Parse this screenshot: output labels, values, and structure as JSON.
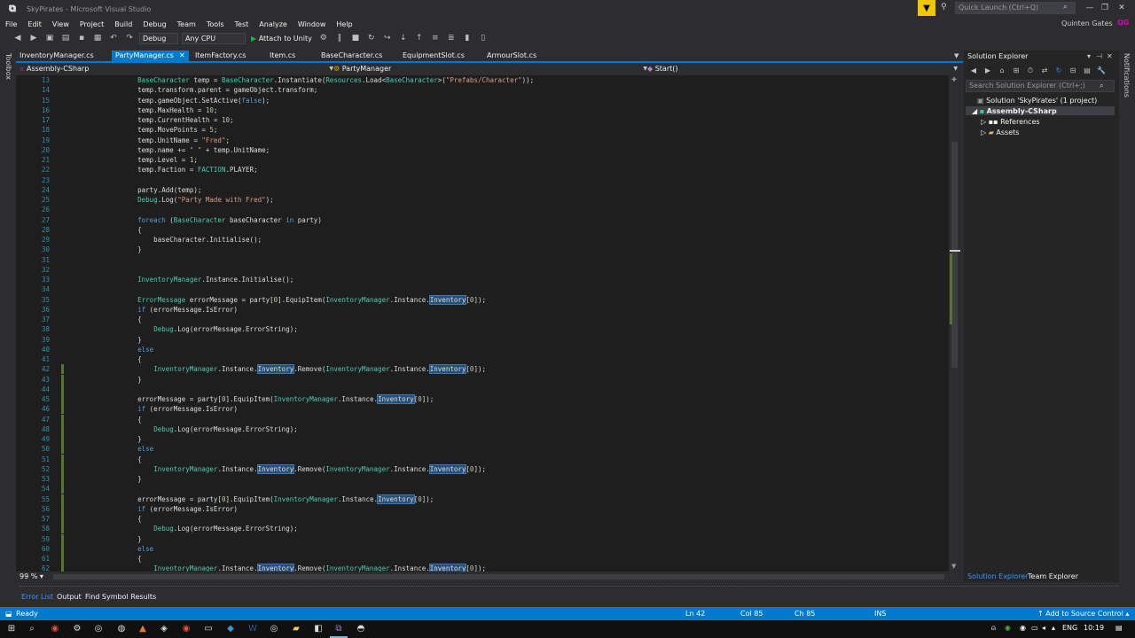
{
  "window": {
    "title": "SkyPirates - Microsoft Visual Studio",
    "quick_launch_placeholder": "Quick Launch (Ctrl+Q)",
    "user_name": "Quinten Gates",
    "user_initials": "QG",
    "minimize": "—",
    "maximize": "❐",
    "close": "✕"
  },
  "menu": [
    "File",
    "Edit",
    "View",
    "Project",
    "Build",
    "Debug",
    "Team",
    "Tools",
    "Test",
    "Analyze",
    "Window",
    "Help"
  ],
  "toolbar": {
    "config": "Debug",
    "platform": "Any CPU",
    "attach": "Attach to Unity"
  },
  "tabs": [
    {
      "label": "InventoryManager.cs",
      "active": false
    },
    {
      "label": "PartyManager.cs",
      "active": true
    },
    {
      "label": "ItemFactory.cs",
      "active": false
    },
    {
      "label": "Item.cs",
      "active": false
    },
    {
      "label": "BaseCharacter.cs",
      "active": false
    },
    {
      "label": "EquipmentSlot.cs",
      "active": false
    },
    {
      "label": "ArmourSlot.cs",
      "active": false
    }
  ],
  "nav": {
    "project": "Assembly-CSharp",
    "type": "PartyManager",
    "member": "Start()"
  },
  "side_labels": {
    "toolbox": "Toolbox",
    "notifications": "Notifications"
  },
  "code_lines": [
    {
      "n": "13",
      "changed": false,
      "segs": [
        {
          "t": "        "
        },
        {
          "t": "BaseCharacter",
          "c": "ty"
        },
        {
          "t": " temp = "
        },
        {
          "t": "BaseCharacter",
          "c": "ty"
        },
        {
          "t": ".Instantiate("
        },
        {
          "t": "Resources",
          "c": "ty"
        },
        {
          "t": ".Load<"
        },
        {
          "t": "BaseCharacter",
          "c": "ty"
        },
        {
          "t": ">("
        },
        {
          "t": "\"Prefabs/Character\"",
          "c": "st"
        },
        {
          "t": "));"
        }
      ]
    },
    {
      "n": "14",
      "changed": false,
      "segs": [
        {
          "t": "        temp.transform.parent = gameObject.transform;"
        }
      ]
    },
    {
      "n": "15",
      "changed": false,
      "segs": [
        {
          "t": "        temp.gameObject.SetActive("
        },
        {
          "t": "false",
          "c": "kw"
        },
        {
          "t": ");"
        }
      ]
    },
    {
      "n": "16",
      "changed": false,
      "segs": [
        {
          "t": "        temp.MaxHealth = "
        },
        {
          "t": "10",
          "c": "nu"
        },
        {
          "t": ";"
        }
      ]
    },
    {
      "n": "17",
      "changed": false,
      "segs": [
        {
          "t": "        temp.CurrentHealth = "
        },
        {
          "t": "10",
          "c": "nu"
        },
        {
          "t": ";"
        }
      ]
    },
    {
      "n": "18",
      "changed": false,
      "segs": [
        {
          "t": "        temp.MovePoints = "
        },
        {
          "t": "5",
          "c": "nu"
        },
        {
          "t": ";"
        }
      ]
    },
    {
      "n": "19",
      "changed": false,
      "segs": [
        {
          "t": "        temp.UnitName = "
        },
        {
          "t": "\"Fred\"",
          "c": "st"
        },
        {
          "t": ";"
        }
      ]
    },
    {
      "n": "20",
      "changed": false,
      "segs": [
        {
          "t": "        temp.name += "
        },
        {
          "t": "\" \"",
          "c": "st"
        },
        {
          "t": " + temp.UnitName;"
        }
      ]
    },
    {
      "n": "21",
      "changed": false,
      "segs": [
        {
          "t": "        temp.Level = "
        },
        {
          "t": "1",
          "c": "nu"
        },
        {
          "t": ";"
        }
      ]
    },
    {
      "n": "22",
      "changed": false,
      "segs": [
        {
          "t": "        temp.Faction = "
        },
        {
          "t": "FACTION",
          "c": "ty"
        },
        {
          "t": ".PLAYER;"
        }
      ]
    },
    {
      "n": "23",
      "changed": false,
      "segs": [
        {
          "t": ""
        }
      ]
    },
    {
      "n": "24",
      "changed": false,
      "segs": [
        {
          "t": "        party.Add(temp);"
        }
      ]
    },
    {
      "n": "25",
      "changed": false,
      "segs": [
        {
          "t": "        "
        },
        {
          "t": "Debug",
          "c": "ty"
        },
        {
          "t": ".Log("
        },
        {
          "t": "\"Party Made with Fred\"",
          "c": "st"
        },
        {
          "t": ");"
        }
      ]
    },
    {
      "n": "26",
      "changed": false,
      "segs": [
        {
          "t": ""
        }
      ]
    },
    {
      "n": "27",
      "changed": false,
      "segs": [
        {
          "t": "        "
        },
        {
          "t": "foreach",
          "c": "kw"
        },
        {
          "t": " ("
        },
        {
          "t": "BaseCharacter",
          "c": "ty"
        },
        {
          "t": " baseCharacter "
        },
        {
          "t": "in",
          "c": "kw"
        },
        {
          "t": " party)"
        }
      ]
    },
    {
      "n": "28",
      "changed": false,
      "segs": [
        {
          "t": "        {"
        }
      ]
    },
    {
      "n": "29",
      "changed": false,
      "segs": [
        {
          "t": "            baseCharacter.Initialise();"
        }
      ]
    },
    {
      "n": "30",
      "changed": false,
      "segs": [
        {
          "t": "        }"
        }
      ]
    },
    {
      "n": "31",
      "changed": false,
      "segs": [
        {
          "t": ""
        }
      ]
    },
    {
      "n": "32",
      "changed": false,
      "segs": [
        {
          "t": ""
        }
      ]
    },
    {
      "n": "33",
      "changed": false,
      "segs": [
        {
          "t": "        "
        },
        {
          "t": "InventoryManager",
          "c": "ty"
        },
        {
          "t": ".Instance.Initialise();"
        }
      ]
    },
    {
      "n": "34",
      "changed": false,
      "segs": [
        {
          "t": ""
        }
      ]
    },
    {
      "n": "35",
      "changed": false,
      "segs": [
        {
          "t": "        "
        },
        {
          "t": "ErrorMessage",
          "c": "ty"
        },
        {
          "t": " errorMessage = party["
        },
        {
          "t": "0",
          "c": "nu"
        },
        {
          "t": "].EquipItem("
        },
        {
          "t": "InventoryManager",
          "c": "ty"
        },
        {
          "t": ".Instance."
        },
        {
          "t": "Inventory",
          "c": "hl"
        },
        {
          "t": "["
        },
        {
          "t": "0",
          "c": "nu"
        },
        {
          "t": "]);"
        }
      ]
    },
    {
      "n": "36",
      "changed": false,
      "segs": [
        {
          "t": "        "
        },
        {
          "t": "if",
          "c": "kw"
        },
        {
          "t": " (errorMessage.IsError)"
        }
      ]
    },
    {
      "n": "37",
      "changed": false,
      "segs": [
        {
          "t": "        {"
        }
      ]
    },
    {
      "n": "38",
      "changed": false,
      "segs": [
        {
          "t": "            "
        },
        {
          "t": "Debug",
          "c": "ty"
        },
        {
          "t": ".Log(errorMessage.ErrorString);"
        }
      ]
    },
    {
      "n": "39",
      "changed": false,
      "segs": [
        {
          "t": "        }"
        }
      ]
    },
    {
      "n": "40",
      "changed": false,
      "segs": [
        {
          "t": "        "
        },
        {
          "t": "else",
          "c": "kw"
        }
      ]
    },
    {
      "n": "41",
      "changed": false,
      "segs": [
        {
          "t": "        {"
        }
      ]
    },
    {
      "n": "42",
      "changed": true,
      "segs": [
        {
          "t": "            "
        },
        {
          "t": "InventoryManager",
          "c": "ty"
        },
        {
          "t": ".Instance."
        },
        {
          "t": "Inventory",
          "c": "hl"
        },
        {
          "t": ".Remove("
        },
        {
          "t": "InventoryManager",
          "c": "ty"
        },
        {
          "t": ".Instance."
        },
        {
          "t": "Inventory",
          "c": "hl"
        },
        {
          "t": "["
        },
        {
          "t": "0",
          "c": "nu"
        },
        {
          "t": "]);"
        }
      ]
    },
    {
      "n": "43",
      "changed": true,
      "segs": [
        {
          "t": "        }"
        }
      ]
    },
    {
      "n": "44",
      "changed": true,
      "segs": [
        {
          "t": ""
        }
      ]
    },
    {
      "n": "45",
      "changed": true,
      "segs": [
        {
          "t": "        errorMessage = party["
        },
        {
          "t": "0",
          "c": "nu"
        },
        {
          "t": "].EquipItem("
        },
        {
          "t": "InventoryManager",
          "c": "ty"
        },
        {
          "t": ".Instance."
        },
        {
          "t": "Inventory",
          "c": "hl"
        },
        {
          "t": "["
        },
        {
          "t": "0",
          "c": "nu"
        },
        {
          "t": "]);"
        }
      ]
    },
    {
      "n": "46",
      "changed": true,
      "segs": [
        {
          "t": "        "
        },
        {
          "t": "if",
          "c": "kw"
        },
        {
          "t": " (errorMessage.IsError)"
        }
      ]
    },
    {
      "n": "47",
      "changed": true,
      "segs": [
        {
          "t": "        {"
        }
      ]
    },
    {
      "n": "48",
      "changed": true,
      "segs": [
        {
          "t": "            "
        },
        {
          "t": "Debug",
          "c": "ty"
        },
        {
          "t": ".Log(errorMessage.ErrorString);"
        }
      ]
    },
    {
      "n": "49",
      "changed": true,
      "segs": [
        {
          "t": "        }"
        }
      ]
    },
    {
      "n": "50",
      "changed": true,
      "segs": [
        {
          "t": "        "
        },
        {
          "t": "else",
          "c": "kw"
        }
      ]
    },
    {
      "n": "51",
      "changed": true,
      "segs": [
        {
          "t": "        {"
        }
      ]
    },
    {
      "n": "52",
      "changed": true,
      "segs": [
        {
          "t": "            "
        },
        {
          "t": "InventoryManager",
          "c": "ty"
        },
        {
          "t": ".Instance."
        },
        {
          "t": "Inventory",
          "c": "hl"
        },
        {
          "t": ".Remove("
        },
        {
          "t": "InventoryManager",
          "c": "ty"
        },
        {
          "t": ".Instance."
        },
        {
          "t": "Inventory",
          "c": "hl"
        },
        {
          "t": "["
        },
        {
          "t": "0",
          "c": "nu"
        },
        {
          "t": "]);"
        }
      ]
    },
    {
      "n": "53",
      "changed": true,
      "segs": [
        {
          "t": "        }"
        }
      ]
    },
    {
      "n": "54",
      "changed": true,
      "segs": [
        {
          "t": ""
        }
      ]
    },
    {
      "n": "55",
      "changed": true,
      "segs": [
        {
          "t": "        errorMessage = party["
        },
        {
          "t": "0",
          "c": "nu"
        },
        {
          "t": "].EquipItem("
        },
        {
          "t": "InventoryManager",
          "c": "ty"
        },
        {
          "t": ".Instance."
        },
        {
          "t": "Inventory",
          "c": "hl"
        },
        {
          "t": "["
        },
        {
          "t": "0",
          "c": "nu"
        },
        {
          "t": "]);"
        }
      ]
    },
    {
      "n": "56",
      "changed": true,
      "segs": [
        {
          "t": "        "
        },
        {
          "t": "if",
          "c": "kw"
        },
        {
          "t": " (errorMessage.IsError)"
        }
      ]
    },
    {
      "n": "57",
      "changed": true,
      "segs": [
        {
          "t": "        {"
        }
      ]
    },
    {
      "n": "58",
      "changed": true,
      "segs": [
        {
          "t": "            "
        },
        {
          "t": "Debug",
          "c": "ty"
        },
        {
          "t": ".Log(errorMessage.ErrorString);"
        }
      ]
    },
    {
      "n": "59",
      "changed": true,
      "segs": [
        {
          "t": "        }"
        }
      ]
    },
    {
      "n": "60",
      "changed": true,
      "segs": [
        {
          "t": "        "
        },
        {
          "t": "else",
          "c": "kw"
        }
      ]
    },
    {
      "n": "61",
      "changed": true,
      "segs": [
        {
          "t": "        {"
        }
      ]
    },
    {
      "n": "62",
      "changed": true,
      "segs": [
        {
          "t": "            "
        },
        {
          "t": "InventoryManager",
          "c": "ty"
        },
        {
          "t": ".Instance."
        },
        {
          "t": "Inventory",
          "c": "hl"
        },
        {
          "t": ".Remove("
        },
        {
          "t": "InventoryManager",
          "c": "ty"
        },
        {
          "t": ".Instance."
        },
        {
          "t": "Inventory",
          "c": "hl"
        },
        {
          "t": "["
        },
        {
          "t": "0",
          "c": "nu"
        },
        {
          "t": "]);"
        }
      ]
    }
  ],
  "editor": {
    "zoom": "99 %"
  },
  "bottom_tabs": [
    "Error List",
    "Output",
    "Find Symbol Results"
  ],
  "solution_explorer": {
    "title": "Solution Explorer",
    "search_placeholder": "Search Solution Explorer (Ctrl+;)",
    "solution": "Solution 'SkyPirates' (1 project)",
    "project": "Assembly-CSharp",
    "items": [
      "References",
      "Assets"
    ],
    "bottom_tabs": [
      "Solution Explorer",
      "Team Explorer"
    ]
  },
  "status": {
    "ready": "Ready",
    "line": "Ln 42",
    "col": "Col 85",
    "ch": "Ch 85",
    "mode": "INS",
    "source_control": "Add to Source Control"
  },
  "taskbar": {
    "language": "ENG",
    "time": "10:19"
  },
  "colors": {
    "accent": "#007acc",
    "editor_bg": "#1e1e1e",
    "keyword": "#569cd6",
    "type": "#4ec9b0",
    "string": "#d69d85"
  }
}
